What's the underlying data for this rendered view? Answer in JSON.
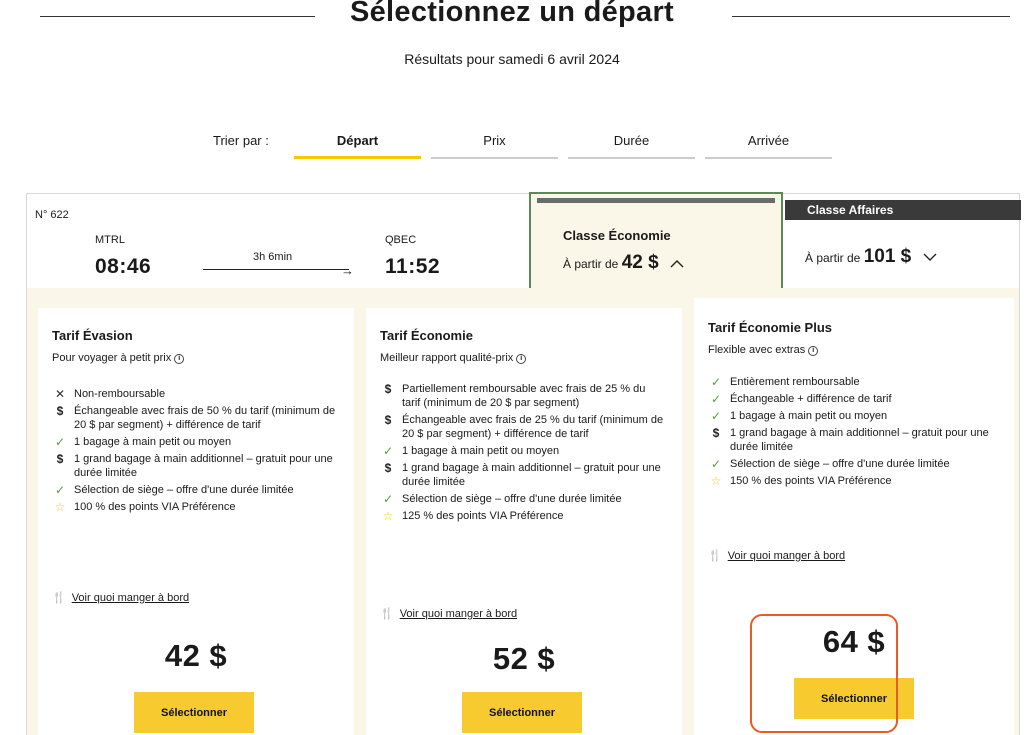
{
  "header": {
    "title": "Sélectionnez un départ",
    "subtitle": "Résultats pour  samedi 6 avril 2024"
  },
  "sort": {
    "label": "Trier par :",
    "tabs": [
      {
        "label": "Départ",
        "active": true
      },
      {
        "label": "Prix",
        "active": false
      },
      {
        "label": "Durée",
        "active": false
      },
      {
        "label": "Arrivée",
        "active": false
      }
    ]
  },
  "trip": {
    "number": "N° 622",
    "origin": "MTRL",
    "destination": "QBEC",
    "departure_time": "08:46",
    "arrival_time": "11:52",
    "duration": "3h 6min"
  },
  "classes": {
    "economy": {
      "title": "Classe Économie",
      "from": "À partir de",
      "price": "42 $"
    },
    "business": {
      "title": "Classe Affaires",
      "from": "À partir de",
      "price": "101 $"
    }
  },
  "fares": [
    {
      "name": "Tarif Évasion",
      "desc": "Pour voyager à petit prix",
      "features": [
        {
          "icon": "cross",
          "text": "Non-remboursable"
        },
        {
          "icon": "dollar",
          "text": "Échangeable avec frais de 50 % du tarif (minimum de 20 $ par segment) + différence de tarif"
        },
        {
          "icon": "check",
          "text": "1 bagage à main petit ou moyen"
        },
        {
          "icon": "dollar",
          "text": "1 grand bagage à main additionnel – gratuit pour une durée limitée"
        },
        {
          "icon": "check",
          "text": "Sélection de siège – offre d'une durée limitée"
        },
        {
          "icon": "star",
          "text": "100 % des points VIA Préférence"
        }
      ],
      "meal": "Voir quoi manger à bord",
      "price": "42 $",
      "button": "Sélectionner"
    },
    {
      "name": "Tarif Économie",
      "desc": "Meilleur rapport qualité-prix",
      "features": [
        {
          "icon": "dollar",
          "text": "Partiellement remboursable avec frais de 25 % du tarif (minimum de 20 $ par segment)"
        },
        {
          "icon": "dollar",
          "text": "Échangeable avec frais de 25 % du tarif (minimum de 20 $ par segment) + différence de tarif"
        },
        {
          "icon": "check",
          "text": "1 bagage à main petit ou moyen"
        },
        {
          "icon": "dollar",
          "text": "1 grand bagage à main additionnel – gratuit pour une durée limitée"
        },
        {
          "icon": "check",
          "text": "Sélection de siège – offre d'une durée limitée"
        },
        {
          "icon": "star",
          "text": "125 % des points VIA Préférence"
        }
      ],
      "meal": "Voir quoi manger à bord",
      "price": "52 $",
      "button": "Sélectionner"
    },
    {
      "name": "Tarif Économie Plus",
      "desc": "Flexible avec extras",
      "features": [
        {
          "icon": "check",
          "text": "Entièrement remboursable"
        },
        {
          "icon": "check",
          "text": "Échangeable + différence de tarif"
        },
        {
          "icon": "check",
          "text": "1 bagage à main petit ou moyen"
        },
        {
          "icon": "dollar",
          "text": "1 grand bagage à main additionnel – gratuit pour une durée limitée"
        },
        {
          "icon": "check",
          "text": "Sélection de siège – offre d'une durée limitée"
        },
        {
          "icon": "star",
          "text": "150 % des points VIA Préférence"
        }
      ],
      "meal": "Voir quoi manger à bord",
      "price": "64 $",
      "button": "Sélectionner"
    }
  ],
  "colors": {
    "accent_yellow": "#f7cb30",
    "panel_bg": "#faf6e8",
    "selected_border": "#5a8a5a",
    "highlight": "#e85a28",
    "check_green": "#5a9a3a"
  }
}
